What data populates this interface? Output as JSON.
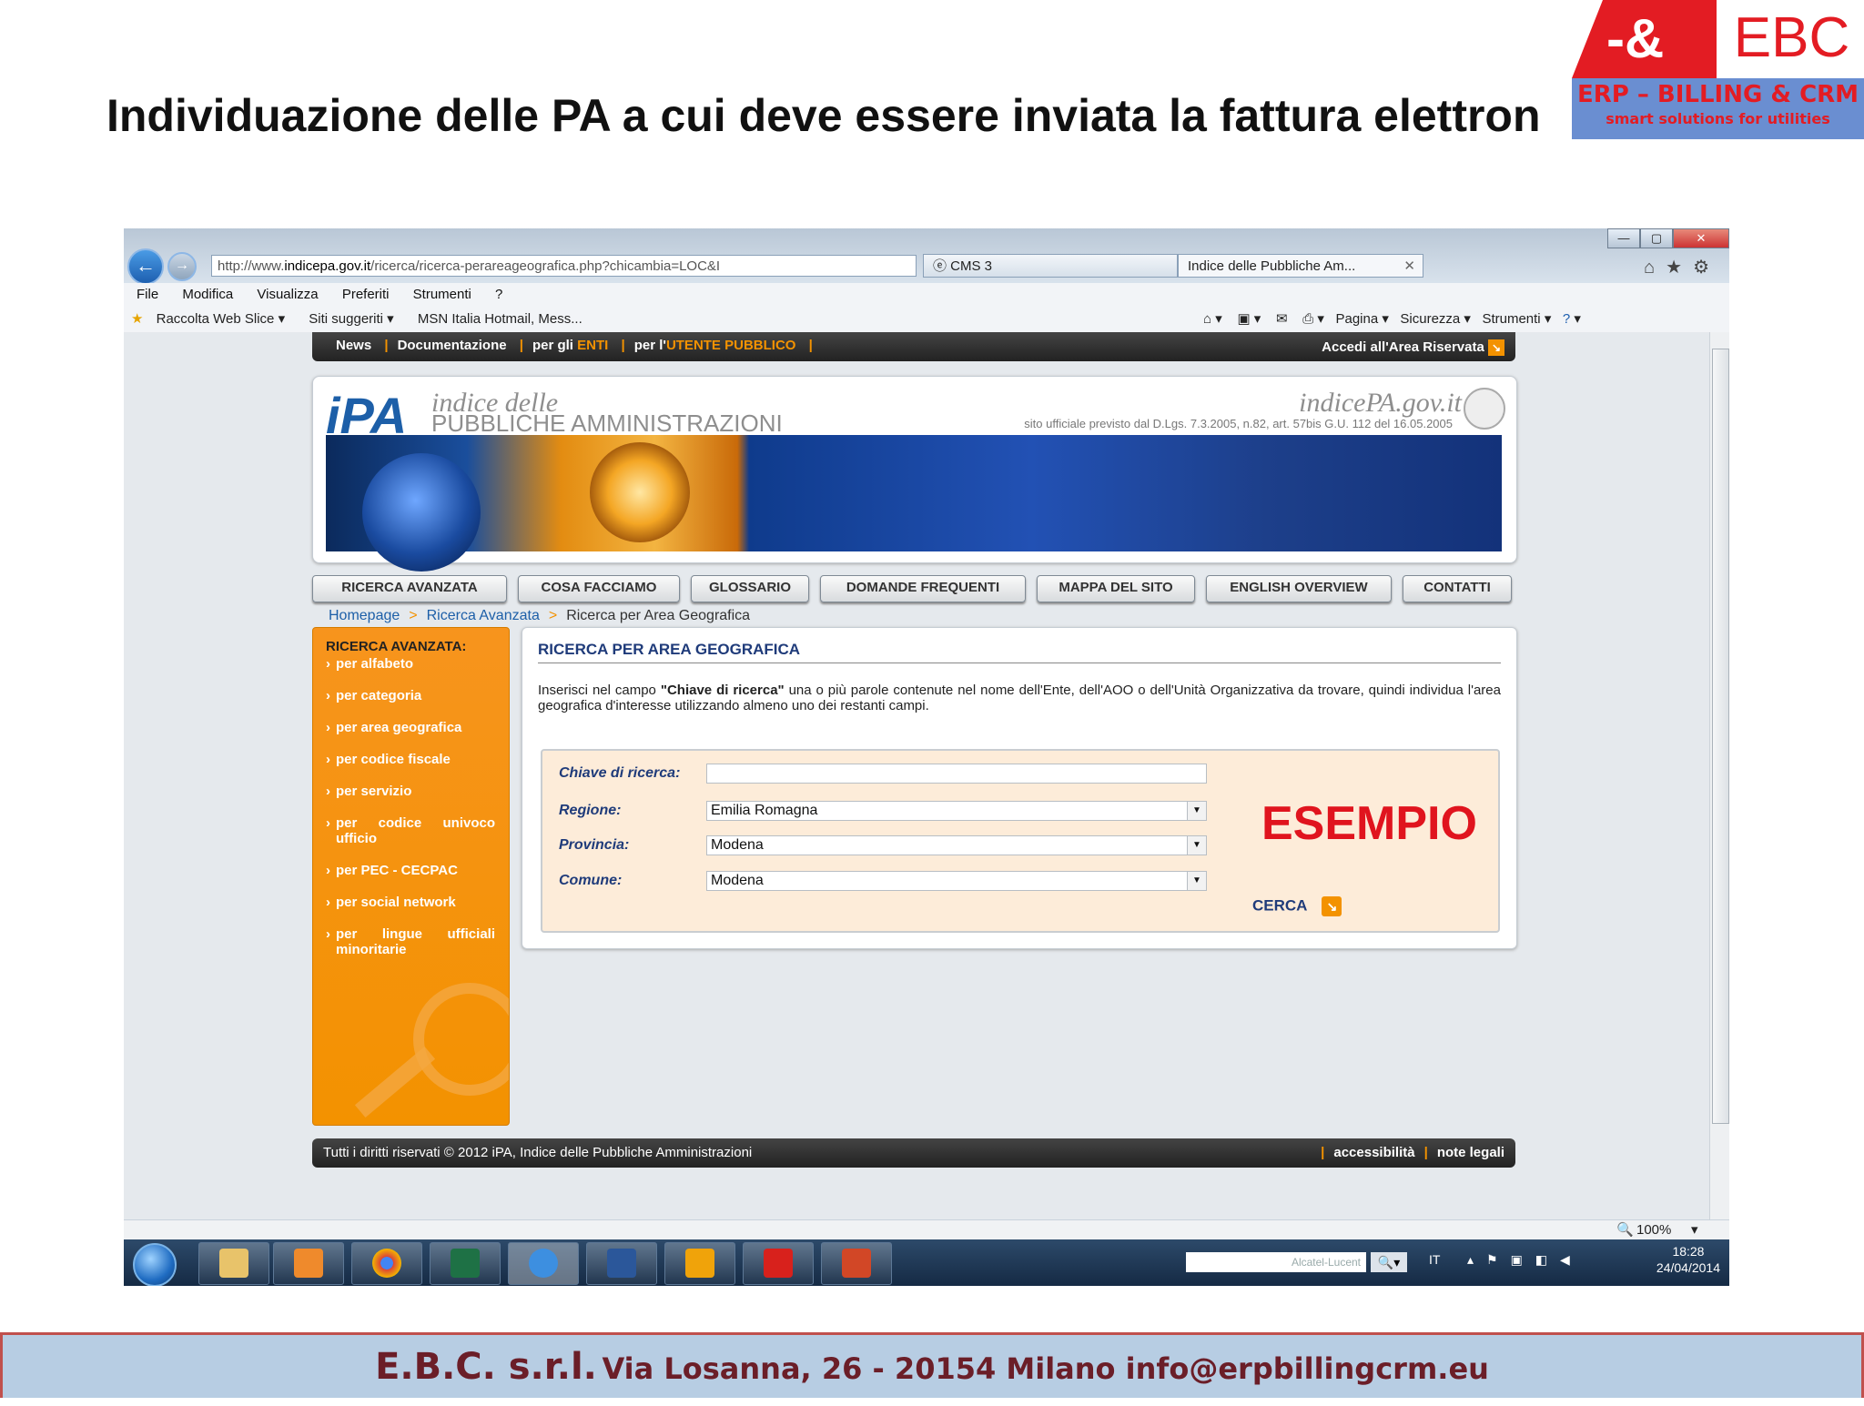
{
  "slide": {
    "title": "Individuazione delle PA a cui deve essere inviata la fattura elettron",
    "logo": {
      "symbol": "-&",
      "name": "EBC",
      "line1": "ERP – BILLING & CRM",
      "line2": "smart solutions for utilities"
    },
    "footer": {
      "company": "E.B.C. s.r.l.",
      "address": "Via Losanna, 26 - 20154 Milano",
      "email": "info@erpbillingcrm.eu"
    }
  },
  "browser": {
    "address": {
      "prefix": "http://www.",
      "domain": "indicepa.gov.it",
      "path": "/ricerca/ricerca-perareageografica.php?chicambia=LOC&I"
    },
    "tabs": [
      {
        "label": "CMS 3"
      },
      {
        "label": "Indice delle Pubbliche Am..."
      }
    ],
    "menu": [
      "File",
      "Modifica",
      "Visualizza",
      "Preferiti",
      "Strumenti",
      "?"
    ],
    "favorites": [
      "Raccolta Web Slice",
      "Siti suggeriti",
      "MSN Italia Hotmail, Mess..."
    ],
    "commands": [
      "Pagina",
      "Sicurezza",
      "Strumenti"
    ],
    "zoom": "100%"
  },
  "site": {
    "topnav": {
      "news": "News",
      "docs": "Documentazione",
      "enti_pre": "per gli ",
      "enti": "ENTI",
      "pub_pre": "per l'",
      "pub": "UTENTE PUBBLICO",
      "reserved": "Accedi all'Area Riservata"
    },
    "banner": {
      "logo": "iPA",
      "sub1": "indice delle",
      "sub2": "PUBBLICHE AMMINISTRAZIONI",
      "site": "indicePA.gov.it",
      "law": "sito ufficiale previsto dal D.Lgs. 7.3.2005, n.82, art. 57bis G.U. 112 del 16.05.2005"
    },
    "menu": [
      "RICERCA AVANZATA",
      "COSA FACCIAMO",
      "GLOSSARIO",
      "DOMANDE FREQUENTI",
      "MAPPA DEL SITO",
      "ENGLISH OVERVIEW",
      "CONTATTI"
    ],
    "breadcrumb": [
      "Homepage",
      "Ricerca Avanzata",
      "Ricerca per Area Geografica"
    ],
    "sidebar": {
      "title": "RICERCA AVANZATA:",
      "items": [
        "per alfabeto",
        "per categoria",
        "per area geografica",
        "per codice fiscale",
        "per servizio",
        "per codice univoco ufficio",
        "per PEC - CECPAC",
        "per social network",
        "per lingue ufficiali minoritarie"
      ]
    },
    "content": {
      "title": "RICERCA PER AREA GEOGRAFICA",
      "desc_pre": "Inserisci nel campo ",
      "desc_bold": "\"Chiave di ricerca\"",
      "desc_post": " una o più parole contenute nel nome dell'Ente, dell'AOO o dell'Unità Organizzativa da trovare, quindi individua l'area geografica d'interesse utilizzando almeno uno dei restanti campi.",
      "form": {
        "key_label": "Chiave di ricerca:",
        "key_value": "",
        "regione_label": "Regione:",
        "regione_value": "Emilia Romagna",
        "provincia_label": "Provincia:",
        "provincia_value": "Modena",
        "comune_label": "Comune:",
        "comune_value": "Modena",
        "search": "CERCA"
      },
      "overlay": "ESEMPIO"
    },
    "footer": {
      "copyright": "Tutti i diritti riservati © 2012 iPA, Indice delle Pubbliche Amministrazioni",
      "access": "accessibilità",
      "legal": "note legali"
    }
  },
  "taskbar": {
    "search_placeholder": "Alcatel-Lucent",
    "lang": "IT",
    "time": "18:28",
    "date": "24/04/2014"
  }
}
